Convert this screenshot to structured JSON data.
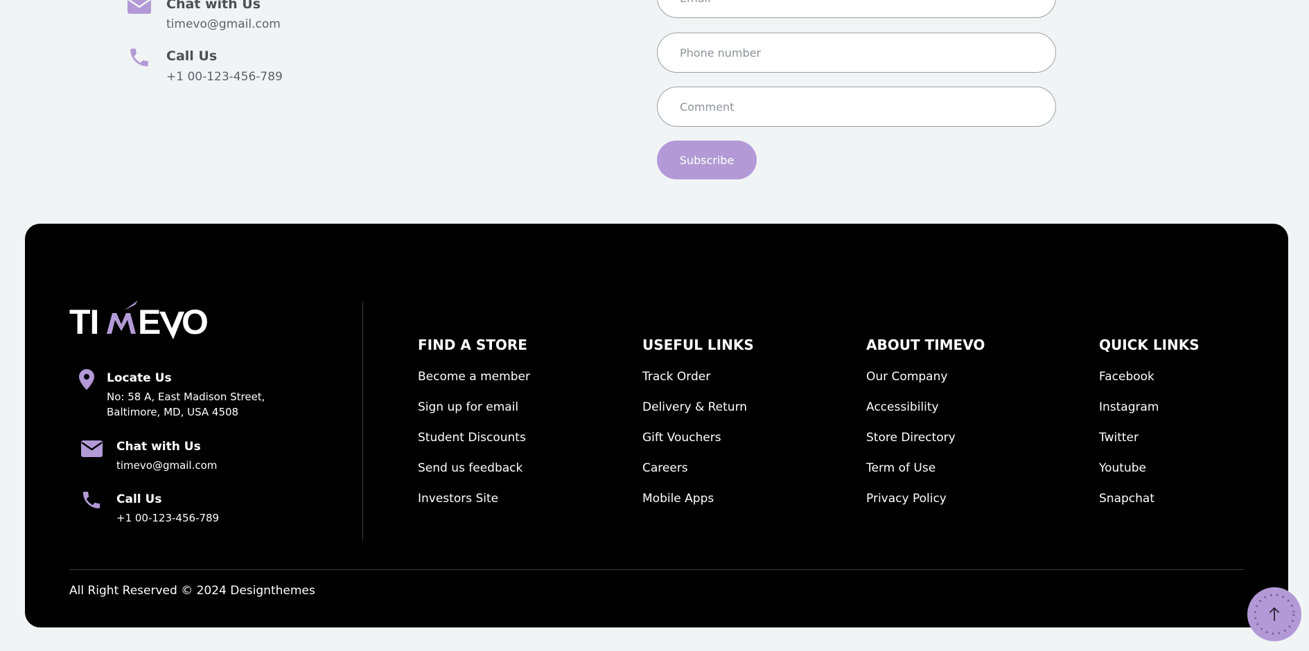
{
  "contact_top": {
    "chat_title": "Chat with Us",
    "chat_value": "timevo@gmail.com",
    "call_title": "Call Us",
    "call_value": "+1 00-123-456-789"
  },
  "form": {
    "email_placeholder": "Email",
    "phone_placeholder": "Phone number",
    "comment_placeholder": "Comment",
    "subscribe_label": "Subscribe"
  },
  "footer": {
    "brand": "TIMEVO",
    "locate_title": "Locate Us",
    "locate_line1": "No: 58 A, East Madison Street,",
    "locate_line2": "Baltimore, MD, USA 4508",
    "chat_title": "Chat with Us",
    "chat_value": "timevo@gmail.com",
    "call_title": "Call Us",
    "call_value": "+1 00-123-456-789",
    "columns": [
      {
        "title": "FIND A STORE",
        "items": [
          "Become a member",
          "Sign up for email",
          "Student Discounts",
          "Send us feedback",
          "Investors Site"
        ]
      },
      {
        "title": "USEFUL LINKS",
        "items": [
          "Track Order",
          "Delivery & Return",
          "Gift Vouchers",
          "Careers",
          "Mobile Apps"
        ]
      },
      {
        "title": "ABOUT TIMEVO",
        "items": [
          "Our Company",
          "Accessibility",
          "Store Directory",
          "Term of Use",
          "Privacy Policy"
        ]
      },
      {
        "title": "QUICK LINKS",
        "items": [
          "Facebook",
          "Instagram",
          "Twitter",
          "Youtube",
          "Snapchat"
        ]
      }
    ],
    "copyright": "All Right Reserved © 2024 Designthemes"
  },
  "icons": {
    "envelope": "envelope-icon",
    "phone": "phone-icon",
    "location": "map-pin-icon",
    "scroll_top": "arrow-up-icon"
  },
  "colors": {
    "accent": "#b39ad6",
    "page_bg": "#f1f4f5",
    "footer_bg": "#000000"
  }
}
